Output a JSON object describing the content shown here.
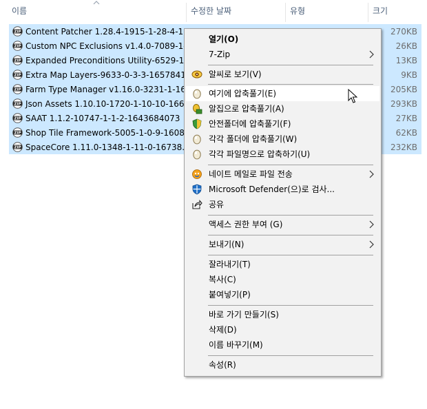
{
  "header": {
    "columns": [
      "이름",
      "수정한 날짜",
      "유형",
      "크기"
    ]
  },
  "files": [
    {
      "name": "Content Patcher 1.28.4-1915-1-28-4-1...",
      "size": "270KB"
    },
    {
      "name": "Custom NPC Exclusions v1.4.0-7089-1-...",
      "size": "26KB"
    },
    {
      "name": "Expanded Preconditions Utility-6529-1-...",
      "size": "13KB"
    },
    {
      "name": "Extra Map Layers-9633-0-3-3-1657841...",
      "size": "9KB"
    },
    {
      "name": "Farm Type Manager v1.16.0-3231-1-16...",
      "size": "205KB"
    },
    {
      "name": "Json Assets 1.10.10-1720-1-10-10-166...",
      "size": "293KB"
    },
    {
      "name": "SAAT 1.1.2-10747-1-1-2-1643684073",
      "size": "27KB"
    },
    {
      "name": "Shop Tile Framework-5005-1-0-9-1608...",
      "size": "62KB"
    },
    {
      "name": "SpaceCore 1.11.0-1348-1-11-0-16738...",
      "size": "232KB"
    }
  ],
  "menu": {
    "open": "열기(O)",
    "sevenzip": "7-Zip",
    "alzip_view": "알씨로 보기(V)",
    "extract_here": "여기에 압축풀기(E)",
    "extract_alzip": "알집으로 압축풀기(A)",
    "extract_safe": "안전폴더에 압축풀기(F)",
    "extract_each_folder": "각각 폴더에 압축풀기(W)",
    "compress_each": "각각 파일명으로 압축하기(U)",
    "naver_mail": "네이트 메일로 파일 전송",
    "defender": "Microsoft Defender(으)로 검사...",
    "share": "공유",
    "grant_access": "액세스 권한 부여 (G)",
    "send_to": "보내기(N)",
    "cut": "잘라내기(T)",
    "copy": "복사(C)",
    "paste": "붙여넣기(P)",
    "create_shortcut": "바로 가기 만들기(S)",
    "delete": "삭제(D)",
    "rename": "이름 바꾸기(M)",
    "properties": "속성(R)"
  }
}
